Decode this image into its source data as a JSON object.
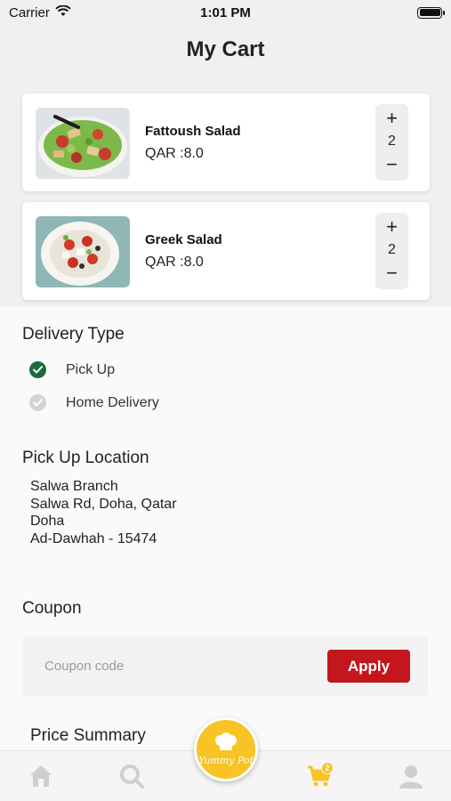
{
  "status_bar": {
    "carrier": "Carrier",
    "time": "1:01 PM"
  },
  "page": {
    "title": "My Cart"
  },
  "cart_items": [
    {
      "name": "Fattoush Salad",
      "price": "QAR :8.0",
      "quantity": "2",
      "increment": "+",
      "decrement": "−"
    },
    {
      "name": "Greek Salad",
      "price": "QAR :8.0",
      "quantity": "2",
      "increment": "+",
      "decrement": "−"
    }
  ],
  "delivery": {
    "heading": "Delivery Type",
    "options": [
      {
        "label": "Pick Up",
        "selected": true
      },
      {
        "label": "Home Delivery",
        "selected": false
      }
    ]
  },
  "pickup_location": {
    "heading": "Pick Up Location",
    "lines": [
      "Salwa Branch",
      "Salwa Rd, Doha, Qatar",
      "Doha",
      "Ad-Dawhah - 15474"
    ]
  },
  "coupon": {
    "heading": "Coupon",
    "placeholder": "Coupon code",
    "value": "",
    "apply_label": "Apply"
  },
  "price_summary": {
    "heading": "Price Summary"
  },
  "bottom_nav": {
    "items": [
      "home-icon",
      "search-icon",
      "logo",
      "cart-icon",
      "profile-icon"
    ],
    "cart_badge": "2",
    "logo_text": "Yummy Pot"
  },
  "colors": {
    "accent_red": "#c4171d",
    "brand_yellow": "#f7c325",
    "check_green": "#1b6b36",
    "unchecked_grey": "#d4d4d4"
  }
}
